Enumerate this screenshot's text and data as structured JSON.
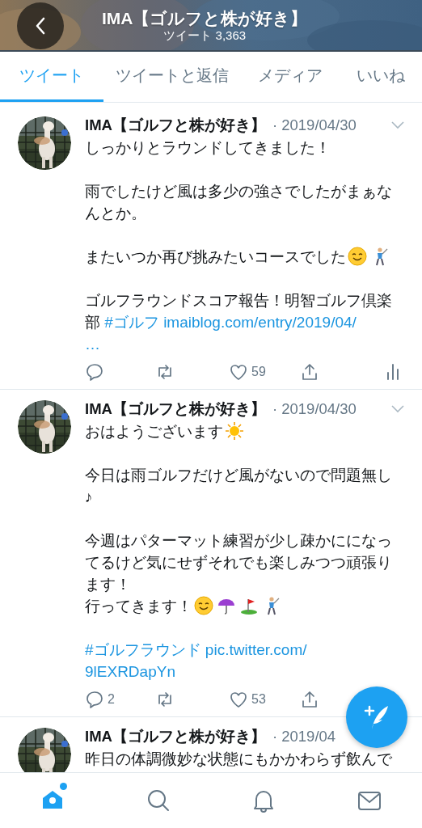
{
  "header": {
    "title": "IMA【ゴルフと株が好き】",
    "subtitle": "ツイート 3,363"
  },
  "tabs": [
    {
      "label": "ツイート",
      "selected": true
    },
    {
      "label": "ツイートと返信",
      "selected": false
    },
    {
      "label": "メディア",
      "selected": false
    },
    {
      "label": "いいね",
      "selected": false
    }
  ],
  "tweets": [
    {
      "name": "IMA【ゴルフと株が好き】",
      "date": "· 2019/04/30",
      "has_menu": true,
      "paragraphs": [
        {
          "lines": [
            [
              {
                "kind": "text",
                "text": "しっかりとラウンドしてきました！"
              }
            ]
          ]
        },
        {
          "lines": [
            [
              {
                "kind": "text",
                "text": "雨でしたけど風は多少の強さでしたがまぁな"
              }
            ],
            [
              {
                "kind": "text",
                "text": "んとか。"
              }
            ]
          ]
        },
        {
          "lines": [
            [
              {
                "kind": "text",
                "text": "またいつか再び挑みたいコースでした"
              },
              {
                "kind": "smile"
              },
              {
                "kind": "golfer"
              }
            ]
          ]
        },
        {
          "lines": [
            [
              {
                "kind": "text",
                "text": "ゴルフラウンドスコア報告！明智ゴルフ倶楽"
              }
            ],
            [
              {
                "kind": "text",
                "text": "部 "
              },
              {
                "kind": "link",
                "text": "#ゴルフ"
              },
              {
                "kind": "link",
                "text": "imaiblog.com/entry/2019/04/"
              }
            ],
            [
              {
                "kind": "link",
                "text": "…"
              }
            ]
          ]
        }
      ],
      "actions": {
        "likes": "59"
      }
    },
    {
      "name": "IMA【ゴルフと株が好き】",
      "date": "· 2019/04/30",
      "has_menu": true,
      "paragraphs": [
        {
          "lines": [
            [
              {
                "kind": "text",
                "text": "おはようございます"
              },
              {
                "kind": "sun"
              }
            ]
          ]
        },
        {
          "lines": [
            [
              {
                "kind": "text",
                "text": "今日は雨ゴルフだけど風がないので問題無し"
              }
            ],
            [
              {
                "kind": "text",
                "text": "♪"
              }
            ]
          ]
        },
        {
          "lines": [
            [
              {
                "kind": "text",
                "text": "今週はパターマット練習が少し疎かにになっ"
              }
            ],
            [
              {
                "kind": "text",
                "text": "てるけど気にせずそれでも楽しみつつ頑張り"
              }
            ],
            [
              {
                "kind": "text",
                "text": "ます！"
              }
            ],
            [
              {
                "kind": "text",
                "text": "行ってきます！"
              },
              {
                "kind": "smile"
              },
              {
                "kind": "umbrella"
              },
              {
                "kind": "flag"
              },
              {
                "kind": "golfer"
              }
            ]
          ]
        },
        {
          "lines": [
            [
              {
                "kind": "link",
                "text": "#ゴルフラウンド"
              },
              {
                "kind": "link",
                "text": "pic.twitter.com/"
              }
            ],
            [
              {
                "kind": "link",
                "text": "9lEXRDapYn"
              }
            ]
          ]
        }
      ],
      "actions": {
        "replies": "2",
        "likes": "53"
      }
    },
    {
      "name": "IMA【ゴルフと株が好き】",
      "date": "· 2019/04",
      "has_menu": false,
      "paragraphs": [
        {
          "lines": [
            [
              {
                "kind": "text",
                "text": "昨日の体調微妙な状態にもかかわらず飲んで"
              }
            ]
          ]
        }
      ]
    }
  ],
  "bottom_nav": [
    {
      "kind": "home",
      "selected": true,
      "dot": true
    },
    {
      "kind": "search",
      "selected": false,
      "dot": false
    },
    {
      "kind": "notifications",
      "selected": false,
      "dot": false
    },
    {
      "kind": "messages",
      "selected": false,
      "dot": false
    }
  ]
}
